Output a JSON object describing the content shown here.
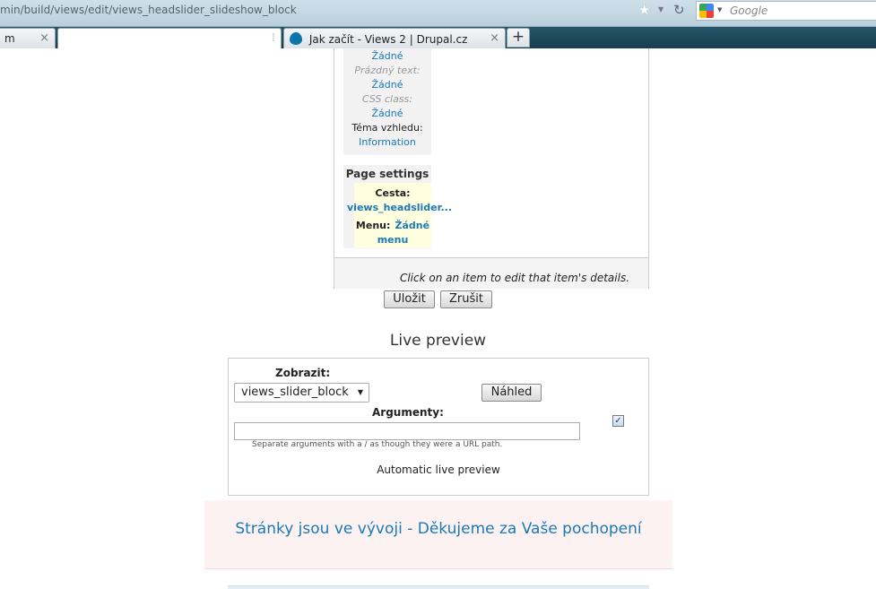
{
  "browser": {
    "url": "min/build/views/edit/views_headslider_slideshow_block",
    "search_placeholder": "Google",
    "tabs": [
      {
        "label": "m"
      },
      {
        "label": ""
      },
      {
        "label": "Jak začít - Views 2 | Drupal.cz"
      }
    ]
  },
  "panel": {
    "block_rows": [
      {
        "text": "Žádné",
        "kind": "link"
      },
      {
        "text": "Prázdný text:",
        "kind": "italic"
      },
      {
        "text": "Žádné",
        "kind": "link"
      },
      {
        "text": "CSS class:",
        "kind": "italic"
      },
      {
        "text": "Žádné",
        "kind": "link"
      },
      {
        "text": "Téma vzhledu:",
        "kind": "plain"
      },
      {
        "text": "Information",
        "kind": "link"
      }
    ],
    "page_settings": {
      "title": "Page settings",
      "path_label": "Cesta:",
      "path_value": "views_headslider...",
      "menu_label": "Menu:",
      "menu_value": "Žádné",
      "menu_value_2": "menu"
    },
    "footer_hint": "Click on an item to edit that item's details."
  },
  "actions": {
    "save": "Uložit",
    "cancel": "Zrušit"
  },
  "live_preview": {
    "title": "Live preview",
    "display_label": "Zobrazit:",
    "display_value": "views_slider_block",
    "preview_button": "Náhled",
    "arguments_label": "Argumenty:",
    "arguments_value": "",
    "arguments_hint": "Separate arguments with a / as though they were a URL path.",
    "auto_preview_checked": true,
    "auto_preview_label": "Automatic live preview"
  },
  "maintenance_message": "Stránky jsou ve vývoji - Děkujeme za Vaše pochopení",
  "colors": {
    "link": "#1a79b7",
    "maintenance_bg": "#fdf2f2"
  }
}
